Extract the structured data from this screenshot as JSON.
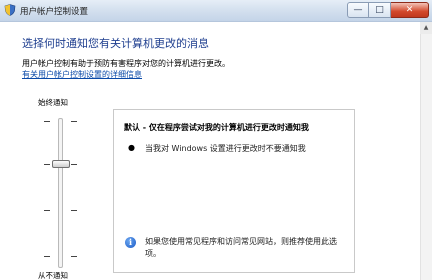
{
  "window": {
    "title": "用户帐户控制设置",
    "buttons": {
      "minimize": "—",
      "maximize": "□",
      "close": "✕"
    }
  },
  "main": {
    "heading": "选择何时通知您有关计算机更改的消息",
    "description": "用户帐户控制有助于预防有害程序对您的计算机进行更改。",
    "help_link": "有关用户帐户控制设置的详细信息"
  },
  "slider": {
    "top_label": "始终通知",
    "bottom_label": "从不通知",
    "level": 3,
    "levels_total": 4
  },
  "info": {
    "title": "默认 - 仅在程序尝试对我的计算机进行更改时通知我",
    "bullet": "当我对 Windows 设置进行更改时不要通知我",
    "recommendation": "如果您使用常见程序和访问常见网站，则推荐使用此选项。"
  },
  "colors": {
    "heading": "#1e3e8f",
    "link": "#0a49a8",
    "close_button": "#d2492c"
  },
  "icons": {
    "app": "shield-icon",
    "info": "info-icon"
  }
}
